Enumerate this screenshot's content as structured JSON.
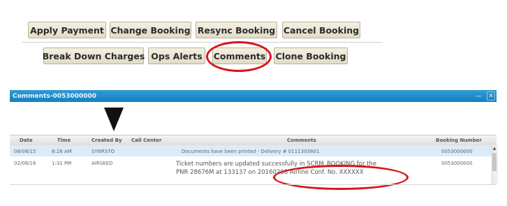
{
  "toolbar": {
    "row1": {
      "apply_payment": "Apply Payment",
      "change_booking": "Change Booking",
      "resync_booking": "Resync Booking",
      "cancel_booking": "Cancel Booking"
    },
    "row2": {
      "break_down_charges": "Break Down Charges",
      "ops_alerts": "Ops Alerts",
      "comments": "Comments",
      "clone_booking": "Clone Booking"
    }
  },
  "panel": {
    "title": "Comments-0053000000",
    "controls": {
      "minimize": "—",
      "close": "✕"
    }
  },
  "grid": {
    "columns": [
      "Date",
      "Time",
      "Created By",
      "Call Center",
      "Comments",
      "Booking Number"
    ],
    "rows": [
      {
        "date": "08/08/15",
        "time": "8:28 AM",
        "created_by": "SYNRSTO",
        "call_center": "",
        "comments": "Documents have been printed - Delivery # 0111303601",
        "booking_number": "0053000000"
      },
      {
        "date": "02/08/16",
        "time": "1:31 PM",
        "created_by": "AIRSKED",
        "call_center": "",
        "comments_line1": "Ticket numbers are updated successfully in SCRM_BOOKING for the",
        "comments_line2": "PNR 28676M at 133137 on 20160208 Airline Conf. No. XXXXXX",
        "booking_number": "0053000000"
      }
    ]
  },
  "colors": {
    "button_bg": "#ebe6d3",
    "highlight": "#d8141c",
    "panel_title_bg": "#1f8bcb",
    "row_selected_bg": "#dcebf8"
  },
  "icons": [
    "down-arrow-pointer-icon",
    "scroll-up-icon"
  ]
}
